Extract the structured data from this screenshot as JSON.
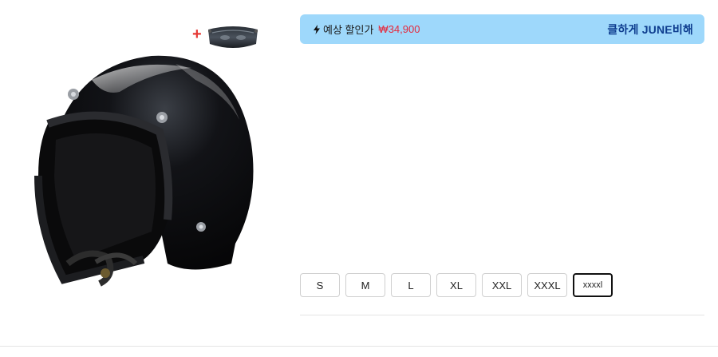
{
  "promo": {
    "icon": "lightning-icon",
    "label": "예상 할인가",
    "price": "₩34,900",
    "action": "클하게 JUNE비해",
    "background_color": "#9ed8fb",
    "price_color": "#e5293c",
    "action_color": "#0d3c8e"
  },
  "product": {
    "visor_addon_symbol": "+",
    "images": [
      "helmet-image",
      "visor-image"
    ]
  },
  "sizes": {
    "options": [
      "S",
      "M",
      "L",
      "XL",
      "XXL",
      "XXXL",
      "xxxxl"
    ],
    "selected": "xxxxl"
  }
}
